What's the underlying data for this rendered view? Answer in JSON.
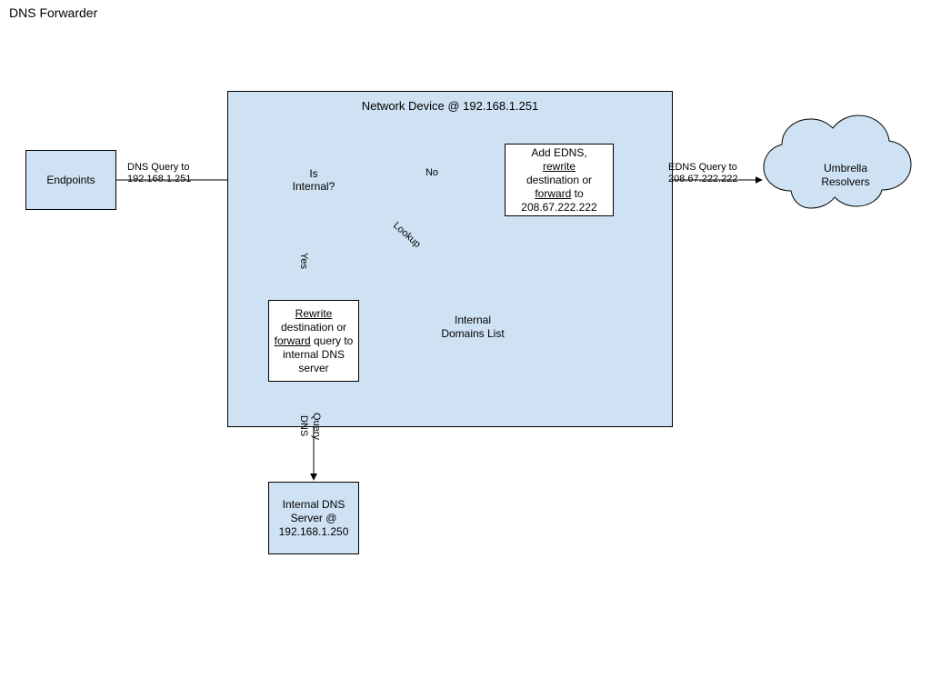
{
  "title": "DNS Forwarder",
  "container": {
    "title": "Network Device @ 192.168.1.251"
  },
  "nodes": {
    "endpoints": "Endpoints",
    "decision_l1": "Is",
    "decision_l2": "Internal?",
    "add_edns_l1": "Add EDNS,",
    "add_edns_l3": " destination or",
    "add_edns_l4": " to",
    "add_edns_l5": "208.67.222.222",
    "add_edns_rewrite": "rewrite",
    "add_edns_forward": "forward",
    "rewrite_l2": " destination or",
    "rewrite_l3": " query to",
    "rewrite_l4": "internal DNS",
    "rewrite_l5": "server",
    "rewrite_rewrite": "Rewrite",
    "rewrite_forward": "forward",
    "domains_l1": "Internal",
    "domains_l2": "Domains List",
    "cloud_l1": "Umbrella",
    "cloud_l2": "Resolvers",
    "internal_dns_l1": "Internal DNS",
    "internal_dns_l2": "Server @",
    "internal_dns_l3": "192.168.1.250"
  },
  "edges": {
    "q_to_device_l1": "DNS Query to",
    "q_to_device_l2": "192.168.1.251",
    "no": "No",
    "yes": "Yes",
    "lookup": "Lookup",
    "edns_l1": "EDNS Query to",
    "edns_l2": "208.67.222.222",
    "dns_query_l1": "DNS",
    "dns_query_l2": "Query"
  }
}
